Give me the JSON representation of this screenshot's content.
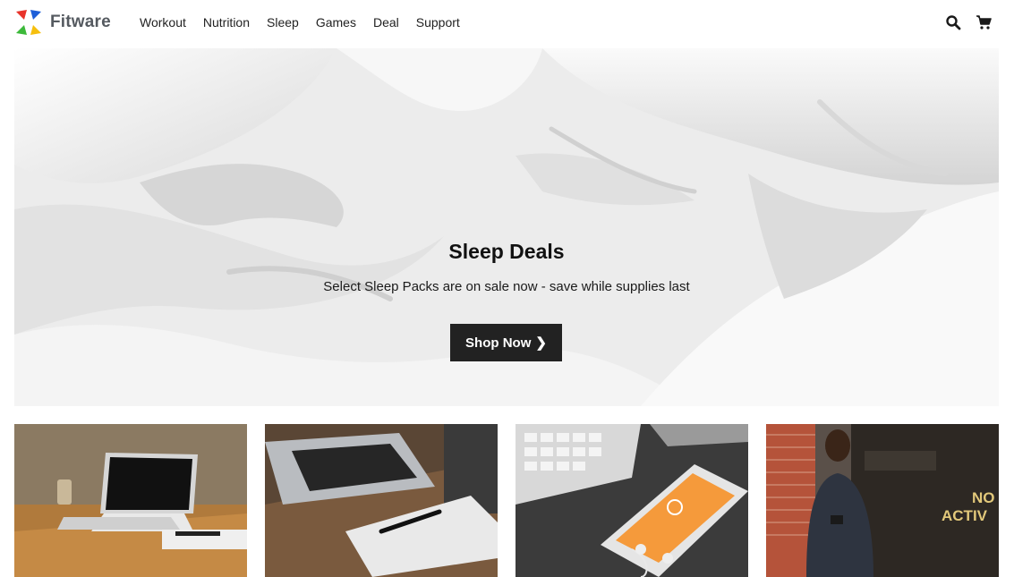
{
  "brand": {
    "name": "Fitware",
    "logo_icon": "pinwheel-logo-icon"
  },
  "nav": {
    "items": [
      {
        "label": "Workout"
      },
      {
        "label": "Nutrition"
      },
      {
        "label": "Sleep"
      },
      {
        "label": "Games"
      },
      {
        "label": "Deal"
      },
      {
        "label": "Support"
      }
    ]
  },
  "header_icons": {
    "search": "search-icon",
    "cart": "cart-icon"
  },
  "hero": {
    "title": "Sleep Deals",
    "subtitle": "Select Sleep Packs are on sale now - save while supplies last",
    "cta_label": "Shop Now",
    "cta_icon": "chevron-right-icon",
    "image": "white-bed-sheets-photo"
  },
  "cards": [
    {
      "image": "laptop-on-wooden-table-photo"
    },
    {
      "image": "laptop-and-notebook-on-desk-photo"
    },
    {
      "image": "phone-keyboard-earbuds-photo"
    },
    {
      "image": "man-with-phone-brick-wall-photo",
      "sign_text_1": "NO",
      "sign_text_2": "ACTIV"
    }
  ],
  "colors": {
    "logo_red": "#e8332a",
    "logo_blue": "#1e5fd8",
    "logo_green": "#3cb93a",
    "logo_yellow": "#f6bf0d",
    "button_bg": "#222222",
    "button_text": "#ffffff"
  }
}
